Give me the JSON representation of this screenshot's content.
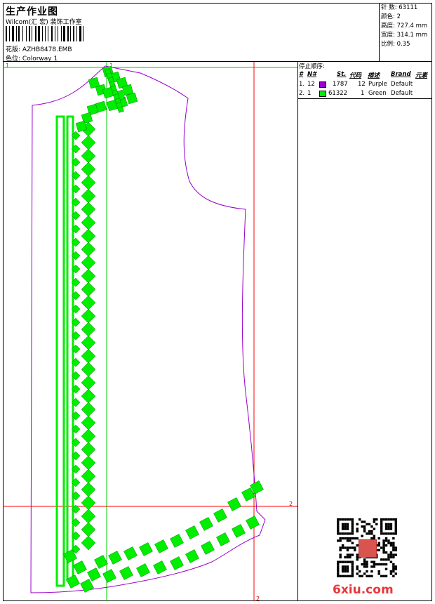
{
  "header": {
    "title": "生产作业图",
    "company": "Wilcom(汇 宏) 装饰工作室",
    "design_label": "花版:",
    "design_value": "AZHB8478.EMB",
    "color_label": "色位:",
    "color_value": "Colorway 1"
  },
  "stats": {
    "stitches": "针 数: 63111",
    "colors": "颜色: 2",
    "height": "高度: 727.4 mm",
    "width": "宽度: 314.1 mm",
    "scale": "比例: 0.35"
  },
  "stop_sequence": {
    "title": "停止顺序:",
    "columns": [
      "#",
      "N#",
      "St.",
      "代码",
      "描述",
      "Brand",
      "元素"
    ],
    "rows": [
      {
        "idx": "1.",
        "n": "12",
        "color": "#9900cc",
        "st": "1787",
        "code": "12",
        "desc": "Purple",
        "brand": "Default"
      },
      {
        "idx": "2.",
        "n": "1",
        "color": "#00ee00",
        "st": "61322",
        "code": "1",
        "desc": "Green",
        "brand": "Default"
      }
    ]
  },
  "markers": {
    "top_left": "1",
    "top_right": "1",
    "right": "2",
    "bottom": "2"
  },
  "watermark": {
    "text": "6xiu.com"
  },
  "colors": {
    "outline": "#9900cc",
    "stitch": "#00ee00",
    "guide_red": "#ff0000",
    "guide_green": "#00cc00"
  }
}
